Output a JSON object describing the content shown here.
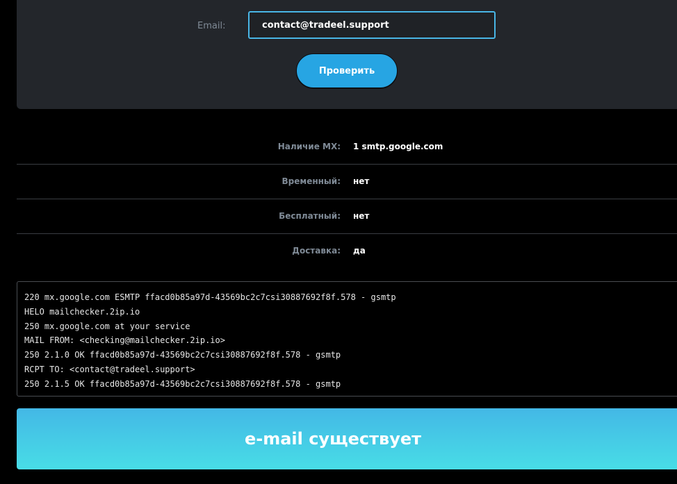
{
  "form": {
    "email_label": "Email:",
    "email_value": "contact@tradeel.support",
    "check_button": "Проверить"
  },
  "results": [
    {
      "label": "Наличие MX:",
      "value": "1 smtp.google.com"
    },
    {
      "label": "Временный:",
      "value": "нет"
    },
    {
      "label": "Бесплатный:",
      "value": "нет"
    },
    {
      "label": "Доставка:",
      "value": "да"
    }
  ],
  "log": [
    "220 mx.google.com ESMTP ffacd0b85a97d-43569bc2c7csi30887692f8f.578 - gsmtp",
    "HELO mailchecker.2ip.io",
    "250 mx.google.com at your service",
    "MAIL FROM: <checking@mailchecker.2ip.io>",
    "250 2.1.0 OK ffacd0b85a97d-43569bc2c7csi30887692f8f.578 - gsmtp",
    "RCPT TO: <contact@tradeel.support>",
    "250 2.1.5 OK ffacd0b85a97d-43569bc2c7csi30887692f8f.578 - gsmtp"
  ],
  "banner": {
    "text": "e-mail существует"
  },
  "colors": {
    "accent": "#27a5e3",
    "input_border": "#49b6e6",
    "panel_bg": "#23262b",
    "banner_top": "#43b8e6",
    "banner_bottom": "#48dde6"
  }
}
